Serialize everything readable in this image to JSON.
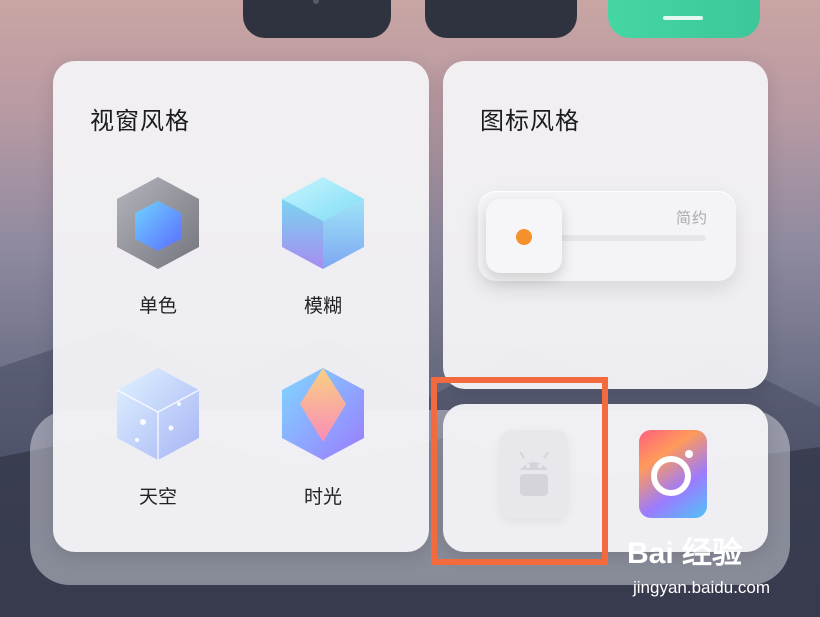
{
  "top_row": {
    "buttons": [
      "dark-tile",
      "dark-tile",
      "green-tile"
    ]
  },
  "window_style": {
    "title": "视窗风格",
    "options": [
      {
        "label": "单色",
        "icon": "mono-cube-icon"
      },
      {
        "label": "模糊",
        "icon": "blur-cube-icon"
      },
      {
        "label": "天空",
        "icon": "sky-cube-icon"
      },
      {
        "label": "时光",
        "icon": "time-cube-icon"
      }
    ]
  },
  "icon_style": {
    "title": "图标风格",
    "slider_label": "简约",
    "slider_value": 0
  },
  "apps": [
    {
      "name": "android-app",
      "icon": "android-icon"
    },
    {
      "name": "camera-app",
      "icon": "camera-icon"
    }
  ],
  "watermark": {
    "brand": "Bai 经验",
    "url": "jingyan.baidu.com"
  },
  "colors": {
    "highlight": "#f26a3d",
    "slider_dot": "#f5902b",
    "top_green": "#45d6a3"
  }
}
